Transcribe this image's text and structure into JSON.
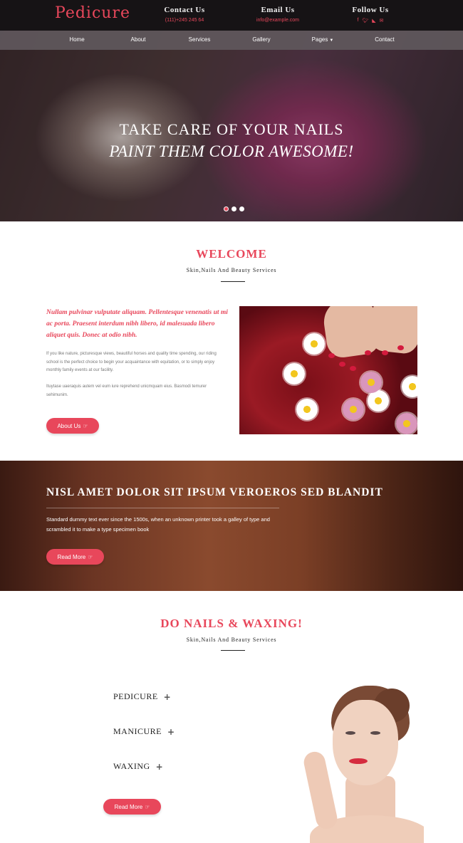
{
  "header": {
    "logo": "Pedicure",
    "contact_us": {
      "heading": "Contact Us",
      "value": "(111)+245 245 64"
    },
    "email_us": {
      "heading": "Email Us",
      "value": "info@example.com"
    },
    "follow_us": {
      "heading": "Follow Us",
      "icons": [
        "facebook-icon",
        "twitter-icon",
        "rss-icon",
        "email-icon"
      ]
    }
  },
  "nav": {
    "items": [
      {
        "label": "Home"
      },
      {
        "label": "About"
      },
      {
        "label": "Services"
      },
      {
        "label": "Gallery"
      },
      {
        "label": "Pages",
        "dropdown": true
      },
      {
        "label": "Contact"
      }
    ]
  },
  "hero": {
    "line1": "TAKE CARE OF YOUR NAILS",
    "line2": "PAINT THEM COLOR AWESOME!",
    "slides": 3,
    "active_slide": 1
  },
  "welcome": {
    "title": "WELCOME",
    "subtitle": "Skin,Nails And Beauty Services",
    "lead": "Nullam pulvinar vulputate aliquam. Pellentesque venenatis ut mi ac porta. Praesent interdum nibh libero, id malesuada libero aliquet quis. Donec at odio nibh.",
    "para1": "If you like nature, picturesque views, beautiful horses and quality time spending, our riding school is the perfect choice to begin your acquaintance with equitation, or to simply enjoy monthly family events at our facility.",
    "para2": "Ituytase uaeraquis autem vel eum iure reprehend unicmquam eius. Basmodi temurer sehimunim.",
    "button": "About Us"
  },
  "banner": {
    "title": "NISL AMET DOLOR SIT IPSUM VEROEROS SED BLANDIT",
    "text": "Standard dummy text ever since the 1500s, when an unknown printer took a galley of type and scrambled it to make a type specimen book",
    "button": "Read More"
  },
  "services": {
    "title": "DO NAILS & WAXING!",
    "subtitle": "Skin,Nails And Beauty Services",
    "items": [
      {
        "label": "PEDICURE"
      },
      {
        "label": "MANICURE"
      },
      {
        "label": "WAXING"
      }
    ],
    "button": "Read More"
  },
  "colors": {
    "accent": "#e8475b",
    "topbar": "#161315",
    "nav": "#5f585c",
    "banner": "#7b3f26"
  }
}
